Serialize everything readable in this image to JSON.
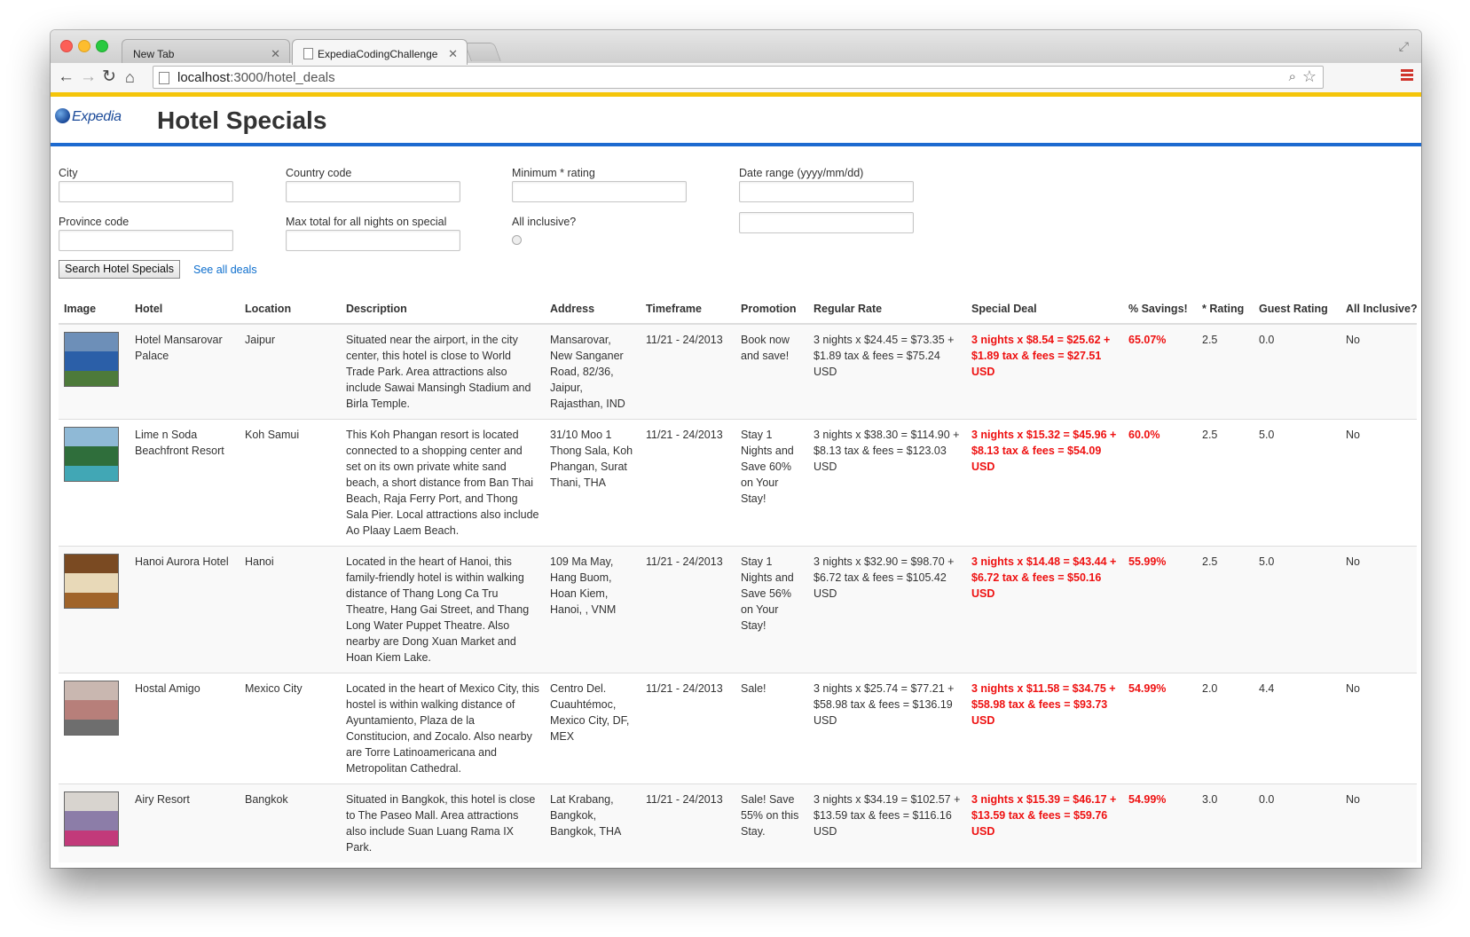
{
  "browser": {
    "tabs": [
      {
        "label": "New Tab",
        "active": false
      },
      {
        "label": "ExpediaCodingChallenge",
        "active": true
      }
    ],
    "url_host": "localhost",
    "url_rest": ":3000/hotel_deals"
  },
  "page": {
    "logo_text": "Expedia",
    "title": "Hotel Specials"
  },
  "form": {
    "city_label": "City",
    "country_label": "Country code",
    "min_rating_label": "Minimum * rating",
    "date_range_label": "Date range (yyyy/mm/dd)",
    "province_label": "Province code",
    "max_total_label": "Max total for all nights on special",
    "all_inclusive_label": "All inclusive?",
    "search_button": "Search Hotel Specials",
    "see_all_link": "See all deals"
  },
  "table": {
    "headers": [
      "Image",
      "Hotel",
      "Location",
      "Description",
      "Address",
      "Timeframe",
      "Promotion",
      "Regular Rate",
      "Special Deal",
      "% Savings!",
      "* Rating",
      "Guest Rating",
      "All Inclusive?"
    ],
    "rows": [
      {
        "hotel": "Hotel Mansarovar Palace",
        "location": "Jaipur",
        "description": "Situated near the airport, in the city center, this hotel is close to World Trade Park. Area attractions also include Sawai Mansingh Stadium and Birla Temple.",
        "address": "Mansarovar, New Sanganer Road, 82/36, Jaipur, Rajasthan, IND",
        "timeframe": "11/21 - 24/2013",
        "promotion": "Book now and save!",
        "regular_rate": "3 nights x $24.45 = $73.35 + $1.89 tax & fees = $75.24 USD",
        "special_deal": "3 nights x $8.54 = $25.62 + $1.89 tax & fees = $27.51 USD",
        "savings": "65.07%",
        "star_rating": "2.5",
        "guest_rating": "0.0",
        "all_inclusive": "No",
        "image_colors": [
          "#6d8fb8",
          "#2b5fa8",
          "#4d7a3a"
        ]
      },
      {
        "hotel": "Lime n Soda Beachfront Resort",
        "location": "Koh Samui",
        "description": "This Koh Phangan resort is located connected to a shopping center and set on its own private white sand beach, a short distance from Ban Thai Beach, Raja Ferry Port, and Thong Sala Pier. Local attractions also include Ao Plaay Laem Beach.",
        "address": "31/10 Moo 1 Thong Sala, Koh Phangan, Surat Thani, THA",
        "timeframe": "11/21 - 24/2013",
        "promotion": "Stay 1 Nights and Save 60% on Your Stay!",
        "regular_rate": "3 nights x $38.30 = $114.90 + $8.13 tax & fees = $123.03 USD",
        "special_deal": "3 nights x $15.32 = $45.96 + $8.13 tax & fees = $54.09 USD",
        "savings": "60.0%",
        "star_rating": "2.5",
        "guest_rating": "5.0",
        "all_inclusive": "No",
        "image_colors": [
          "#8fb9d6",
          "#2f6e3b",
          "#41a7b5"
        ]
      },
      {
        "hotel": "Hanoi Aurora Hotel",
        "location": "Hanoi",
        "description": "Located in the heart of Hanoi, this family-friendly hotel is within walking distance of Thang Long Ca Tru Theatre, Hang Gai Street, and Thang Long Water Puppet Theatre. Also nearby are Dong Xuan Market and Hoan Kiem Lake.",
        "address": "109 Ma May, Hang Buom, Hoan Kiem, Hanoi, , VNM",
        "timeframe": "11/21 - 24/2013",
        "promotion": "Stay 1 Nights and Save 56% on Your Stay!",
        "regular_rate": "3 nights x $32.90 = $98.70 + $6.72 tax & fees = $105.42 USD",
        "special_deal": "3 nights x $14.48 = $43.44 + $6.72 tax & fees = $50.16 USD",
        "savings": "55.99%",
        "star_rating": "2.5",
        "guest_rating": "5.0",
        "all_inclusive": "No",
        "image_colors": [
          "#7a4a22",
          "#e8d9b8",
          "#a0642a"
        ]
      },
      {
        "hotel": "Hostal Amigo",
        "location": "Mexico City",
        "description": "Located in the heart of Mexico City, this hostel is within walking distance of Ayuntamiento, Plaza de la Constitucion, and Zocalo. Also nearby are Torre Latinoamericana and Metropolitan Cathedral.",
        "address": "Centro Del. Cuauhtémoc, Mexico City, DF, MEX",
        "timeframe": "11/21 - 24/2013",
        "promotion": "Sale!",
        "regular_rate": "3 nights x $25.74 = $77.21 + $58.98 tax & fees = $136.19 USD",
        "special_deal": "3 nights x $11.58 = $34.75 + $58.98 tax & fees = $93.73 USD",
        "savings": "54.99%",
        "star_rating": "2.0",
        "guest_rating": "4.4",
        "all_inclusive": "No",
        "image_colors": [
          "#c9b7b0",
          "#b77f7a",
          "#6e6e6e"
        ]
      },
      {
        "hotel": "Airy Resort",
        "location": "Bangkok",
        "description": "Situated in Bangkok, this hotel is close to The Paseo Mall. Area attractions also include Suan Luang Rama IX Park.",
        "address": "Lat Krabang, Bangkok, Bangkok, THA",
        "timeframe": "11/21 - 24/2013",
        "promotion": "Sale! Save 55% on this Stay.",
        "regular_rate": "3 nights x $34.19 = $102.57 + $13.59 tax & fees = $116.16 USD",
        "special_deal": "3 nights x $15.39 = $46.17 + $13.59 tax & fees = $59.76 USD",
        "savings": "54.99%",
        "star_rating": "3.0",
        "guest_rating": "0.0",
        "all_inclusive": "No",
        "image_colors": [
          "#d8d4cf",
          "#8c7da8",
          "#c23a7a"
        ]
      }
    ]
  }
}
